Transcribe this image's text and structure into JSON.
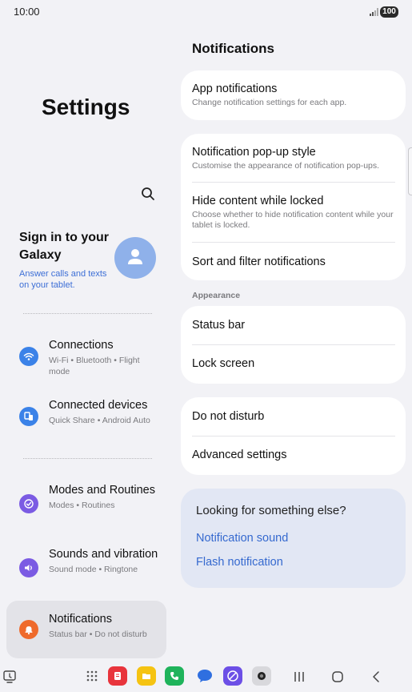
{
  "status_bar": {
    "time": "10:00",
    "battery": "100"
  },
  "left": {
    "title": "Settings",
    "account": {
      "title": "Sign in to your Galaxy",
      "subtitle": "Answer calls and texts on your tablet."
    },
    "items": [
      {
        "title": "Connections",
        "subtitle": "Wi-Fi  •  Bluetooth  •  Flight mode",
        "icon": "wifi-icon",
        "color": "#3b82e8"
      },
      {
        "title": "Connected devices",
        "subtitle": "Quick Share  •  Android Auto",
        "icon": "connected-devices-icon",
        "color": "#3b82e8"
      },
      {
        "title": "Modes and Routines",
        "subtitle": "Modes  •  Routines",
        "icon": "modes-icon",
        "color": "#7b5be3"
      },
      {
        "title": "Sounds and vibration",
        "subtitle": "Sound mode  •  Ringtone",
        "icon": "sound-icon",
        "color": "#7b5be3"
      },
      {
        "title": "Notifications",
        "subtitle": "Status bar  •  Do not disturb",
        "icon": "bell-icon",
        "color": "#ef6a2b"
      }
    ]
  },
  "right": {
    "title": "Notifications",
    "app_notifications": {
      "title": "App notifications",
      "subtitle": "Change notification settings for each app."
    },
    "popup_style": {
      "title": "Notification pop-up style",
      "subtitle": "Customise the appearance of notification pop-ups."
    },
    "hide_content": {
      "title": "Hide content while locked",
      "subtitle": "Choose whether to hide notification content while your tablet is locked."
    },
    "sort_filter": {
      "title": "Sort and filter notifications"
    },
    "appearance_label": "Appearance",
    "status_bar": {
      "title": "Status bar"
    },
    "lock_screen": {
      "title": "Lock screen"
    },
    "do_not_disturb": {
      "title": "Do not disturb"
    },
    "advanced": {
      "title": "Advanced settings"
    },
    "suggest": {
      "title": "Looking for something else?",
      "links": [
        "Notification sound",
        "Flash notification"
      ]
    }
  },
  "navbar": {
    "apps": [
      {
        "icon": "app-drawer-icon",
        "color": "#555555"
      },
      {
        "icon": "notes-app-icon",
        "color": "#e8343c"
      },
      {
        "icon": "files-app-icon",
        "color": "#f5c312"
      },
      {
        "icon": "phone-app-icon",
        "color": "#1fb35b"
      },
      {
        "icon": "messages-app-icon",
        "color": "#2f6fe0"
      },
      {
        "icon": "internet-app-icon",
        "color": "#6c4fe6"
      },
      {
        "icon": "camera-app-icon",
        "color": "#9a9a9e"
      }
    ]
  },
  "colors": {
    "accent": "#3b82e8",
    "link": "#3569cf",
    "background": "#f2f2f6",
    "card": "#ffffff"
  }
}
